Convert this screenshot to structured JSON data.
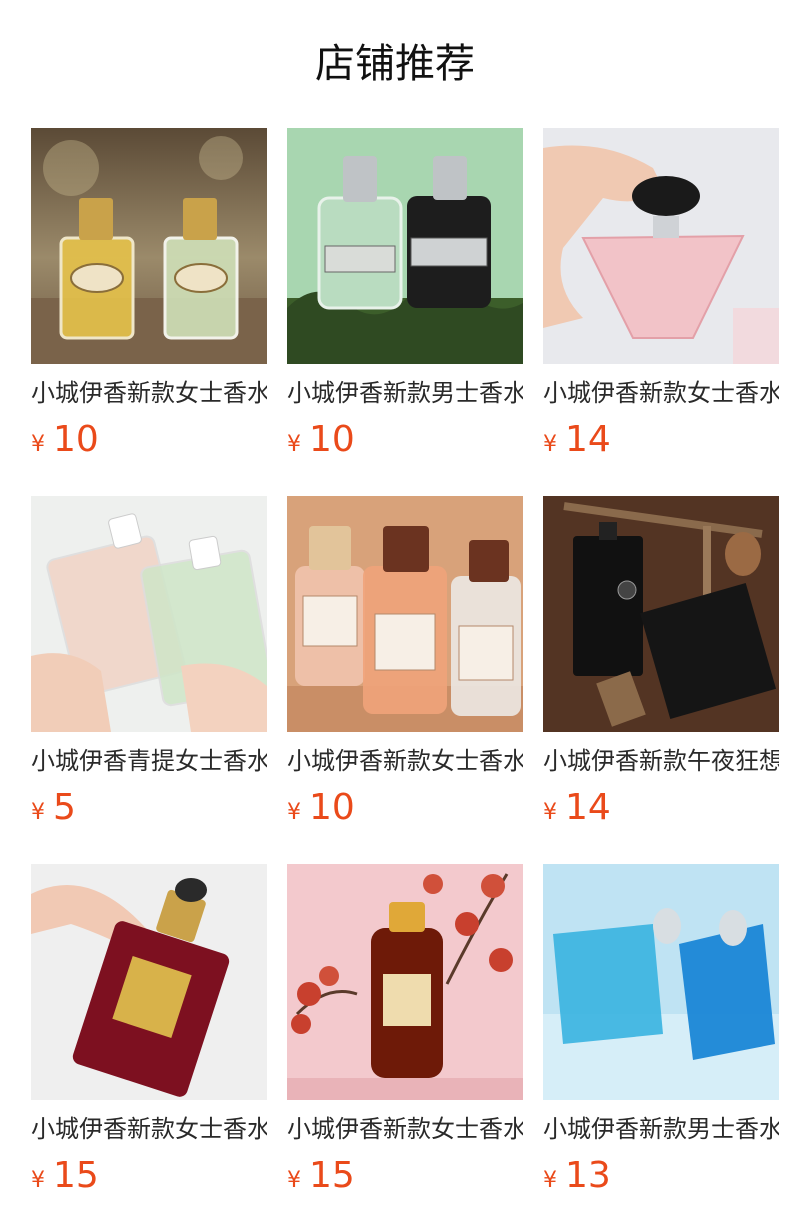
{
  "page": {
    "title": "店铺推荐"
  },
  "products": [
    {
      "name": "小城伊香新款女士香水",
      "currency": "¥",
      "price": "10",
      "image": "two-perfume-bottles-yellow-green"
    },
    {
      "name": "小城伊香新款男士香水",
      "currency": "¥",
      "price": "10",
      "image": "super-man-green-black-bottles"
    },
    {
      "name": "小城伊香新款女士香水",
      "currency": "¥",
      "price": "14",
      "image": "pink-triangle-bottle-in-hand"
    },
    {
      "name": "小城伊香青提女士香水",
      "currency": "¥",
      "price": "5",
      "image": "pink-green-bottles-in-hands"
    },
    {
      "name": "小城伊香新款女士香水",
      "currency": "¥",
      "price": "10",
      "image": "three-bottles-003-005-007"
    },
    {
      "name": "小城伊香新款午夜狂想",
      "currency": "¥",
      "price": "14",
      "image": "black-bottle-and-box-on-wood"
    },
    {
      "name": "小城伊香新款女士香水",
      "currency": "¥",
      "price": "15",
      "image": "dark-red-bottle-in-hand"
    },
    {
      "name": "小城伊香新款女士香水",
      "currency": "¥",
      "price": "15",
      "image": "amber-bottle-with-orchid"
    },
    {
      "name": "小城伊香新款男士香水",
      "currency": "¥",
      "price": "13",
      "image": "two-blue-bottles"
    }
  ]
}
